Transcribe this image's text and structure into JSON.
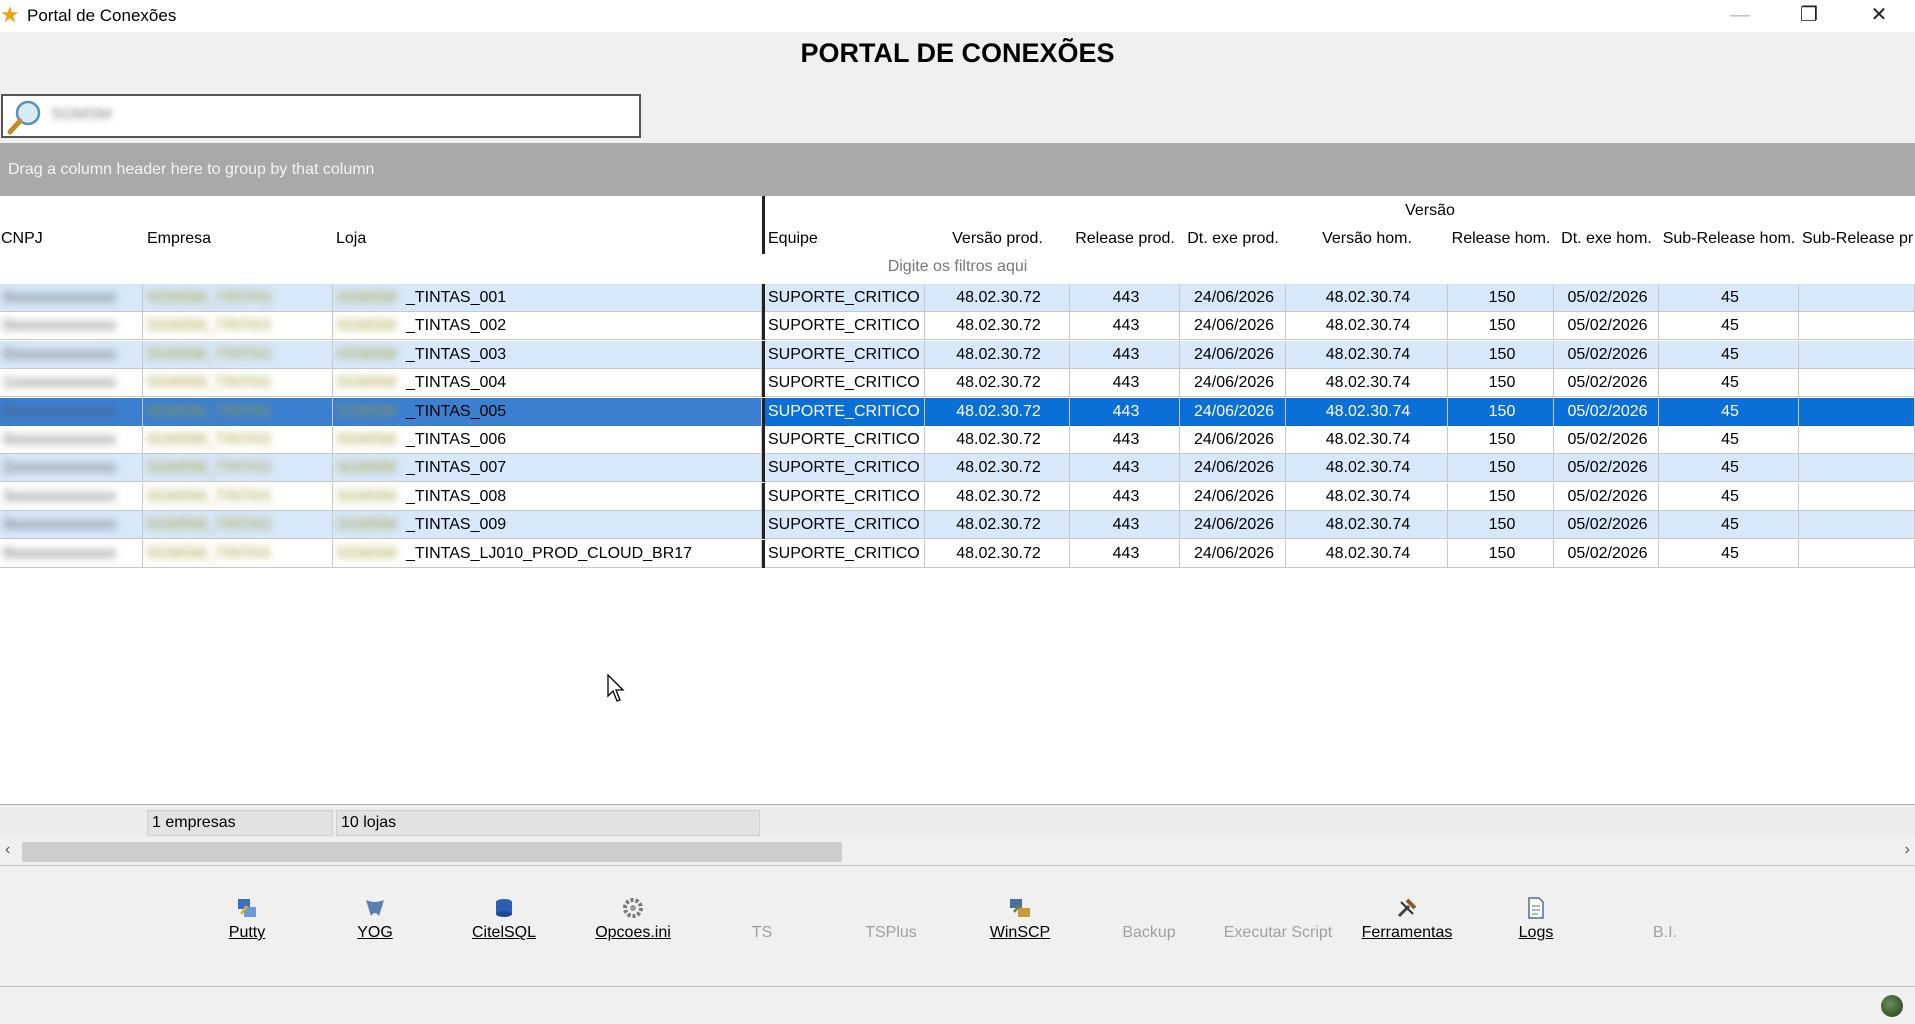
{
  "window": {
    "title": "Portal de Conexões",
    "minimize_icon": "—",
    "restore_icon": "❐",
    "close_icon": "✕"
  },
  "header": {
    "title": "PORTAL DE CONEXÕES"
  },
  "search": {
    "value": "SGMSM"
  },
  "group_bar": {
    "text": "Drag a column header here to group by that column"
  },
  "grid": {
    "band_label": "Versão",
    "columns": [
      "CNPJ",
      "Empresa",
      "Loja",
      "Equipe",
      "Versão prod.",
      "Release prod.",
      "Dt. exe prod.",
      "Versão hom.",
      "Release hom.",
      "Dt. exe hom.",
      "Sub-Release hom.",
      "Sub-Release pr"
    ],
    "filter_hint": "Digite os filtros aqui",
    "selected_row": 4,
    "rows": [
      {
        "cnpj": "0xxxxxxxxxxxxx",
        "empresa": "SGMSM_TINTAS",
        "loja": "TINTAS_001",
        "equipe": "SUPORTE_CRITICO",
        "versao_prod": "48.02.30.72",
        "release_prod": "443",
        "dt_prod": "24/06/2026",
        "versao_hom": "48.02.30.74",
        "release_hom": "150",
        "dt_hom": "05/02/2026",
        "sub_release_hom": "45"
      },
      {
        "cnpj": "0xxxxxxxxxxxxx",
        "empresa": "SGMSM_TINTAS",
        "loja": "TINTAS_002",
        "equipe": "SUPORTE_CRITICO",
        "versao_prod": "48.02.30.72",
        "release_prod": "443",
        "dt_prod": "24/06/2026",
        "versao_hom": "48.02.30.74",
        "release_hom": "150",
        "dt_hom": "05/02/2026",
        "sub_release_hom": "45"
      },
      {
        "cnpj": "0xxxxxxxxxxxxx",
        "empresa": "SGMSM_TINTAS",
        "loja": "TINTAS_003",
        "equipe": "SUPORTE_CRITICO",
        "versao_prod": "48.02.30.72",
        "release_prod": "443",
        "dt_prod": "24/06/2026",
        "versao_hom": "48.02.30.74",
        "release_hom": "150",
        "dt_hom": "05/02/2026",
        "sub_release_hom": "45"
      },
      {
        "cnpj": "1xxxxxxxxxxxxx",
        "empresa": "SGMSM_TINTAS",
        "loja": "TINTAS_004",
        "equipe": "SUPORTE_CRITICO",
        "versao_prod": "48.02.30.72",
        "release_prod": "443",
        "dt_prod": "24/06/2026",
        "versao_hom": "48.02.30.74",
        "release_hom": "150",
        "dt_hom": "05/02/2026",
        "sub_release_hom": "45"
      },
      {
        "cnpj": "8xxxxxxxxxxxxx",
        "empresa": "SGMSM_TINTAS",
        "loja": "TINTAS_005",
        "equipe": "SUPORTE_CRITICO",
        "versao_prod": "48.02.30.72",
        "release_prod": "443",
        "dt_prod": "24/06/2026",
        "versao_hom": "48.02.30.74",
        "release_hom": "150",
        "dt_hom": "05/02/2026",
        "sub_release_hom": "45"
      },
      {
        "cnpj": "0xxxxxxxxxxxxx",
        "empresa": "SGMSM_TINTAS",
        "loja": "TINTAS_006",
        "equipe": "SUPORTE_CRITICO",
        "versao_prod": "48.02.30.72",
        "release_prod": "443",
        "dt_prod": "24/06/2026",
        "versao_hom": "48.02.30.74",
        "release_hom": "150",
        "dt_hom": "05/02/2026",
        "sub_release_hom": "45"
      },
      {
        "cnpj": "2xxxxxxxxxxxxx",
        "empresa": "SGMSM_TINTAS",
        "loja": "TINTAS_007",
        "equipe": "SUPORTE_CRITICO",
        "versao_prod": "48.02.30.72",
        "release_prod": "443",
        "dt_prod": "24/06/2026",
        "versao_hom": "48.02.30.74",
        "release_hom": "150",
        "dt_hom": "05/02/2026",
        "sub_release_hom": "45"
      },
      {
        "cnpj": "3xxxxxxxxxxxxx",
        "empresa": "SGMSM_TINTAS",
        "loja": "TINTAS_008",
        "equipe": "SUPORTE_CRITICO",
        "versao_prod": "48.02.30.72",
        "release_prod": "443",
        "dt_prod": "24/06/2026",
        "versao_hom": "48.02.30.74",
        "release_hom": "150",
        "dt_hom": "05/02/2026",
        "sub_release_hom": "45"
      },
      {
        "cnpj": "4xxxxxxxxxxxxx",
        "empresa": "SGMSM_TINTAS",
        "loja": "TINTAS_009",
        "equipe": "SUPORTE_CRITICO",
        "versao_prod": "48.02.30.72",
        "release_prod": "443",
        "dt_prod": "24/06/2026",
        "versao_hom": "48.02.30.74",
        "release_hom": "150",
        "dt_hom": "05/02/2026",
        "sub_release_hom": "45"
      },
      {
        "cnpj": "9xxxxxxxxxxxxx",
        "empresa": "SGMSM_TINTAS",
        "loja": "TINTAS_LJ010_PROD_CLOUD_BR17",
        "equipe": "SUPORTE_CRITICO",
        "versao_prod": "48.02.30.72",
        "release_prod": "443",
        "dt_prod": "24/06/2026",
        "versao_hom": "48.02.30.74",
        "release_hom": "150",
        "dt_hom": "05/02/2026",
        "sub_release_hom": "45"
      }
    ],
    "summary": {
      "empresas": "1 empresas",
      "lojas": "10 lojas"
    },
    "scroll_left_icon": "‹",
    "scroll_right_icon": "›"
  },
  "toolbar": [
    {
      "label": "Putty",
      "icon": "putty-icon",
      "enabled": true,
      "color": "#3a6fc4"
    },
    {
      "label": "YOG",
      "icon": "yog-icon",
      "enabled": true,
      "color": "#5a7fb0"
    },
    {
      "label": "CitelSQL",
      "icon": "database-icon",
      "enabled": true,
      "color": "#2a5fb5"
    },
    {
      "label": "Opcoes.ini",
      "icon": "gear-icon",
      "enabled": true,
      "color": "#777777"
    },
    {
      "label": "TS",
      "icon": "",
      "enabled": false,
      "color": "#a0a0a0"
    },
    {
      "label": "TSPlus",
      "icon": "",
      "enabled": false,
      "color": "#a0a0a0"
    },
    {
      "label": "WinSCP",
      "icon": "winscp-icon",
      "enabled": true,
      "color": "#6a8a3a"
    },
    {
      "label": "Backup",
      "icon": "",
      "enabled": false,
      "color": "#a0a0a0"
    },
    {
      "label": "Executar Script",
      "icon": "",
      "enabled": false,
      "color": "#a0a0a0"
    },
    {
      "label": "Ferramentas",
      "icon": "tools-icon",
      "enabled": true,
      "color": "#8a5a2a"
    },
    {
      "label": "Logs",
      "icon": "document-icon",
      "enabled": true,
      "color": "#4a6fa0"
    },
    {
      "label": "B.I.",
      "icon": "",
      "enabled": false,
      "color": "#a0a0a0"
    }
  ],
  "colors": {
    "selected_row": "#0a6fd6",
    "alt_row": "#d6e8fa",
    "group_bar": "#a9a9a9"
  }
}
